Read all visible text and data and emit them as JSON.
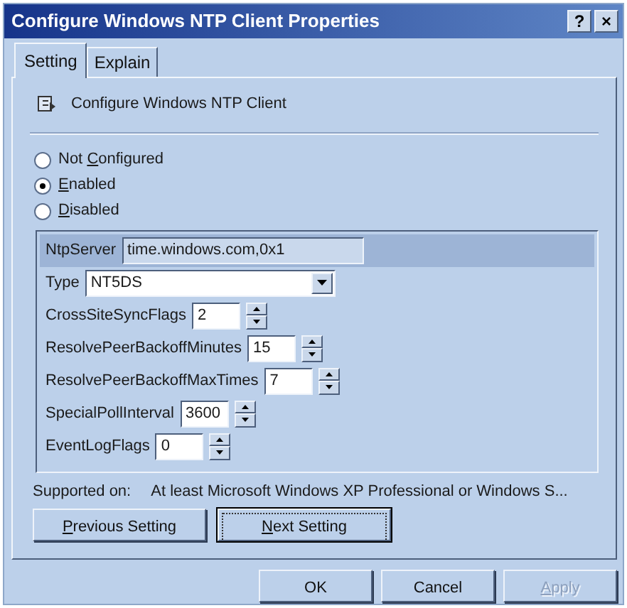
{
  "window": {
    "title": "Configure Windows NTP Client Properties",
    "title_buttons": [
      "?",
      "×"
    ]
  },
  "tabs": [
    {
      "label": "Setting",
      "selected": true
    },
    {
      "label": "Explain",
      "selected": false
    }
  ],
  "policy": {
    "name": "Configure Windows NTP Client"
  },
  "options": [
    {
      "before": "Not ",
      "key": "C",
      "after": "onfigured",
      "selected": false
    },
    {
      "key": "E",
      "after": "nabled",
      "selected": true
    },
    {
      "key": "D",
      "after": "isabled",
      "selected": false
    }
  ],
  "settings": [
    {
      "kind": "text",
      "label": "NtpServer",
      "value": "time.windows.com,0x1",
      "focused": true
    },
    {
      "kind": "dropdown",
      "label": "Type",
      "value": "NT5DS",
      "focused": false
    },
    {
      "kind": "spin",
      "label": "CrossSiteSyncFlags",
      "value": "2",
      "focused": false
    },
    {
      "kind": "spin",
      "label": "ResolvePeerBackoffMinutes",
      "value": "15",
      "focused": false
    },
    {
      "kind": "spin",
      "label": "ResolvePeerBackoffMaxTimes",
      "value": "7",
      "focused": false
    },
    {
      "kind": "spin",
      "label": "SpecialPollInterval",
      "value": "3600",
      "focused": false
    },
    {
      "kind": "spin",
      "label": "EventLogFlags",
      "value": "0",
      "focused": false
    }
  ],
  "supported_on": {
    "label": "Supported on:",
    "value": "At least Microsoft Windows XP Professional or Windows S..."
  },
  "nav_buttons": [
    {
      "key": "P",
      "after": "revious Setting",
      "focused": false
    },
    {
      "key": "N",
      "after": "ext Setting",
      "focused": true
    }
  ],
  "dialog_buttons": [
    {
      "before": "OK",
      "disabled": false
    },
    {
      "before": "Cancel",
      "disabled": false
    },
    {
      "key": "A",
      "after": "pply",
      "disabled": true
    }
  ]
}
